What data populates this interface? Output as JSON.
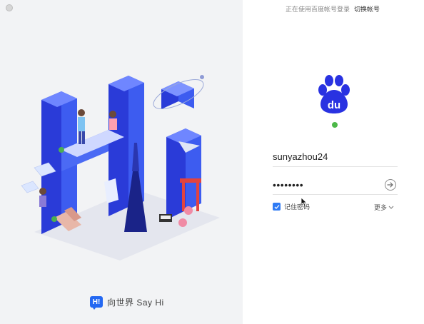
{
  "header": {
    "logged_in_note": "正在使用百度帐号登录",
    "switch_account": "切换帐号"
  },
  "illustration": {
    "slogan": "向世界 Say Hi",
    "slogan_icon_letter": "H!"
  },
  "login": {
    "username": "sunyazhou24",
    "password_mask": "••••••••",
    "status_color": "#4cb848",
    "remember_label": "记住密码",
    "remember_checked": true,
    "more_label": "更多"
  },
  "colors": {
    "brand_blue": "#2468f2",
    "baidu_blue": "#2932e1",
    "checkbox_blue": "#2f7bf4"
  },
  "icons": {
    "submit": "arrow-right-circle-icon",
    "logo": "baidu-paw-icon",
    "more": "chevron-down-icon",
    "close": "close-dot-icon",
    "cursor": "mouse-pointer-icon"
  }
}
